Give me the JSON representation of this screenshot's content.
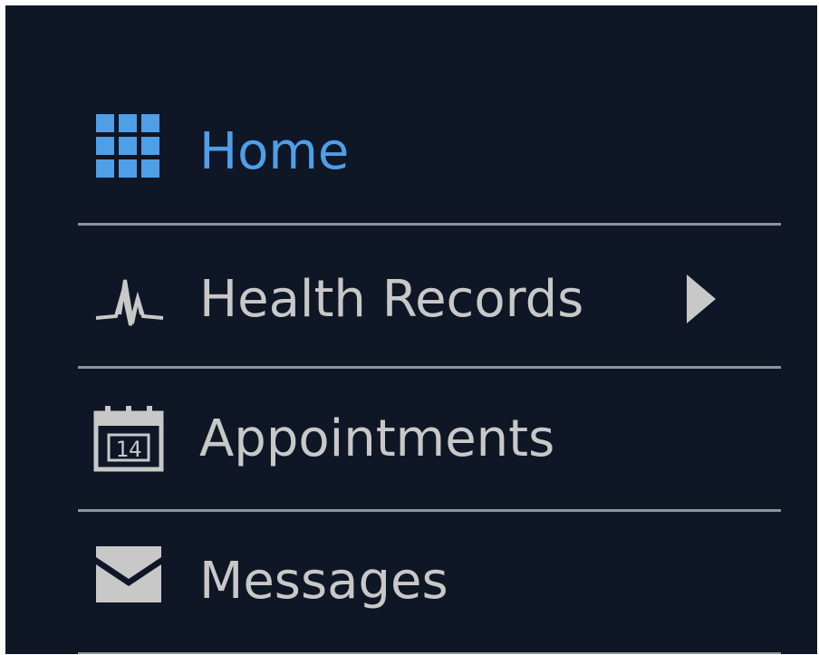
{
  "nav": {
    "items": [
      {
        "label": "Home",
        "icon": "grid-icon",
        "active": true
      },
      {
        "label": "Health Records",
        "icon": "heartbeat-icon",
        "has_submenu": true
      },
      {
        "label": "Appointments",
        "icon": "calendar-icon",
        "icon_text": "14"
      },
      {
        "label": "Messages",
        "icon": "envelope-icon"
      }
    ]
  },
  "colors": {
    "background": "#0f1626",
    "active": "#4f9ee8",
    "inactive": "#c8c8c8",
    "divider": "#8f949b"
  }
}
